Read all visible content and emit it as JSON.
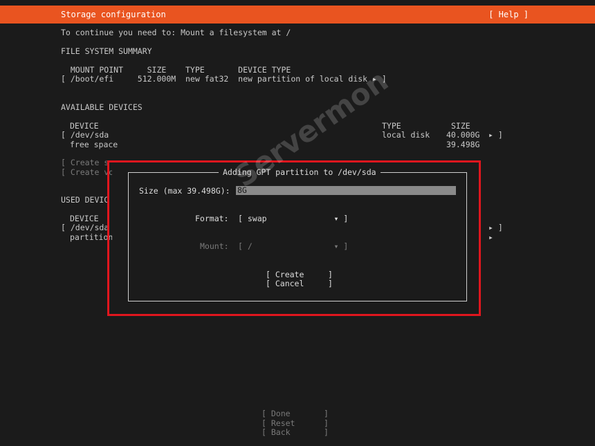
{
  "header": {
    "title": "Storage configuration",
    "help": "[ Help ]"
  },
  "intro": "To continue you need to: Mount a filesystem at /",
  "fs_summary": {
    "heading": "FILE SYSTEM SUMMARY",
    "header_row": "  MOUNT POINT     SIZE    TYPE       DEVICE TYPE",
    "rows": [
      "[ /boot/efi     512.000M  new fat32  new partition of local disk ▸ ]"
    ]
  },
  "available": {
    "heading": "AVAILABLE DEVICES",
    "col_device": "DEVICE",
    "col_type": "TYPE",
    "col_size": "SIZE",
    "dev_name": "[ /dev/sda",
    "dev_type": "local disk",
    "dev_size": "40.000G",
    "dev_arrow": "▸ ]",
    "free_label": "free space",
    "free_size": "39.498G",
    "create1": "[ Create s",
    "create2": "[ Create vo"
  },
  "used": {
    "heading": "USED DEVIC",
    "col_device": "DEVICE",
    "dev_name": "[ /dev/sda",
    "dev_arrow": "▸ ]",
    "part_label": "partition",
    "part_arrow": "▸"
  },
  "dialog": {
    "title": "Adding GPT partition to /dev/sda",
    "size_label": "Size (max 39.498G):",
    "size_value": "8G",
    "format_label": "Format:",
    "format_value": "[ swap              ▾ ]",
    "mount_label": "Mount:",
    "mount_value": "[ /                 ▾ ]",
    "create": "[ Create     ]",
    "cancel": "[ Cancel     ]"
  },
  "footer": {
    "done": "[ Done       ]",
    "reset": "[ Reset      ]",
    "back": "[ Back       ]"
  },
  "watermark": "Servermon",
  "colors": {
    "accent": "#e95420",
    "highlight": "#e0161e",
    "background": "#1b1b1b"
  }
}
